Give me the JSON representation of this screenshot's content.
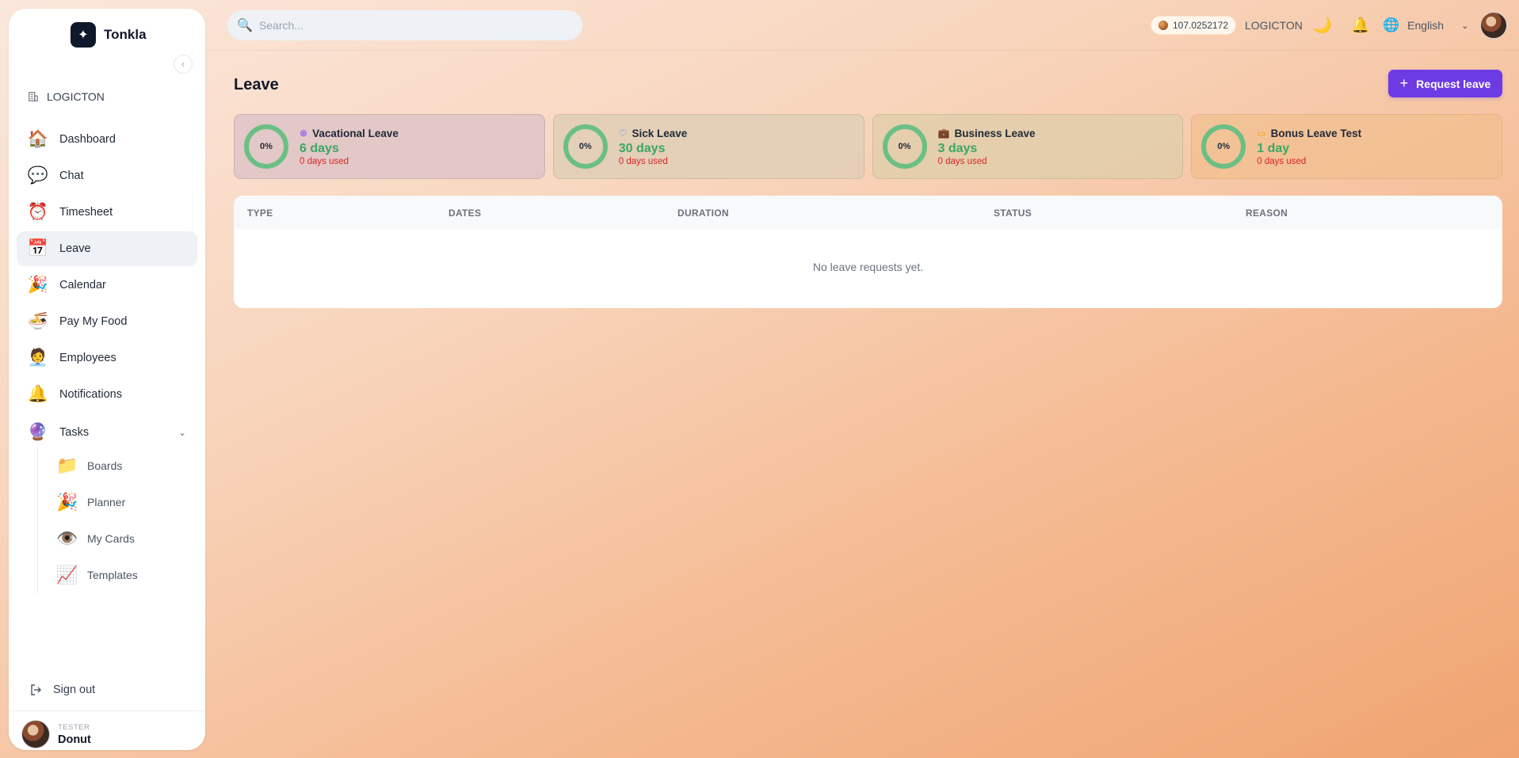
{
  "app": {
    "name": "Tonkla"
  },
  "sidebar": {
    "org": "LOGICTON",
    "items": [
      {
        "label": "Dashboard",
        "icon": "house-icon",
        "glyph": "🏠"
      },
      {
        "label": "Chat",
        "icon": "chat-bubbles-icon",
        "glyph": "💬"
      },
      {
        "label": "Timesheet",
        "icon": "alarm-clock-icon",
        "glyph": "⏰"
      },
      {
        "label": "Leave",
        "icon": "calendar-icon",
        "glyph": "📅",
        "active": true
      },
      {
        "label": "Calendar",
        "icon": "party-popper-icon",
        "glyph": "🎉"
      },
      {
        "label": "Pay My Food",
        "icon": "food-bowl-icon",
        "glyph": "🍜"
      },
      {
        "label": "Employees",
        "icon": "person-icon",
        "glyph": "🧑‍💼"
      },
      {
        "label": "Notifications",
        "icon": "bell-icon",
        "glyph": "🔔"
      },
      {
        "label": "Tasks",
        "icon": "grid-icon",
        "glyph": "🔮"
      }
    ],
    "sub_items": [
      {
        "label": "Boards",
        "icon": "folder-icon",
        "glyph": "📁"
      },
      {
        "label": "Planner",
        "icon": "party-popper-icon",
        "glyph": "🎉"
      },
      {
        "label": "My Cards",
        "icon": "eye-icon",
        "glyph": "👁️"
      },
      {
        "label": "Templates",
        "icon": "chart-icon",
        "glyph": "📈"
      }
    ],
    "sign_out": "Sign out",
    "user": {
      "role": "TESTER",
      "name": "Donut"
    }
  },
  "topbar": {
    "search_placeholder": "Search...",
    "coin_balance": "107.0252172",
    "org": "LOGICTON",
    "language": "English"
  },
  "main": {
    "title": "Leave",
    "request_button": "Request leave",
    "cards": [
      {
        "name": "Vacational Leave",
        "percent": "0%",
        "days": "6 days",
        "used": "0 days used",
        "icon": "globe-icon",
        "glyph": "⊛"
      },
      {
        "name": "Sick Leave",
        "percent": "0%",
        "days": "30 days",
        "used": "0 days used",
        "icon": "heart-icon",
        "glyph": "♡"
      },
      {
        "name": "Business Leave",
        "percent": "0%",
        "days": "3 days",
        "used": "0 days used",
        "icon": "briefcase-icon",
        "glyph": "💼"
      },
      {
        "name": "Bonus Leave Test",
        "percent": "0%",
        "days": "1 day",
        "used": "0 days used",
        "icon": "calendar-outline-icon",
        "glyph": "▭"
      }
    ],
    "table": {
      "columns": [
        "TYPE",
        "DATES",
        "DURATION",
        "STATUS",
        "REASON"
      ],
      "empty_message": "No leave requests yet."
    }
  },
  "colors": {
    "accent": "#6d3be4",
    "ring": "#6bbf85",
    "days_green": "#3aa864",
    "used_red": "#dc2626"
  }
}
